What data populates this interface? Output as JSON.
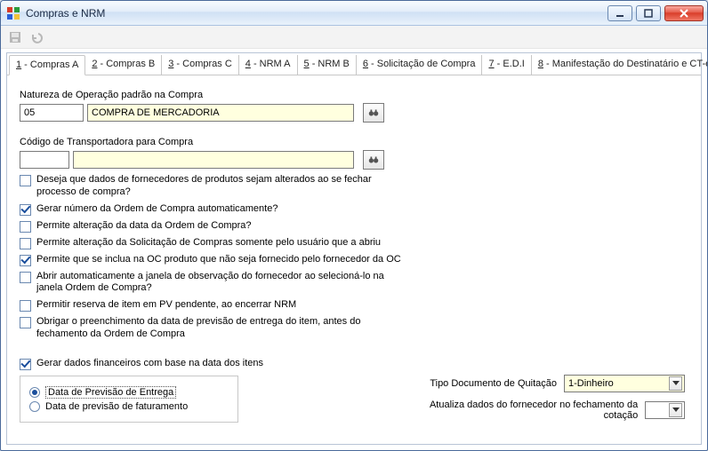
{
  "window": {
    "title": "Compras e NRM"
  },
  "tabs": [
    {
      "u": "1",
      "rest": " - Compras A",
      "active": true
    },
    {
      "u": "2",
      "rest": " - Compras B"
    },
    {
      "u": "3",
      "rest": " - Compras C"
    },
    {
      "u": "4",
      "rest": " - NRM A"
    },
    {
      "u": "5",
      "rest": " - NRM B"
    },
    {
      "u": "6",
      "rest": " - Solicitação de Compra"
    },
    {
      "u": "7",
      "rest": " - E.D.I"
    },
    {
      "u": "8",
      "rest": " - Manifestação do Destinatário e CT-e"
    }
  ],
  "fields": {
    "natureza_label": "Natureza de Operação padrão na Compra",
    "natureza_code": "05",
    "natureza_desc": "COMPRA DE MERCADORIA",
    "transp_label": "Código de Transportadora para Compra",
    "transp_code": "",
    "transp_desc": ""
  },
  "checkboxes": [
    {
      "label": "Deseja que dados de fornecedores de produtos sejam alterados ao se fechar processo de compra?",
      "checked": false
    },
    {
      "label": "Gerar número da Ordem de Compra automaticamente?",
      "checked": true
    },
    {
      "label": "Permite alteração da data da Ordem de Compra?",
      "checked": false
    },
    {
      "label": "Permite alteração da Solicitação de Compras somente pelo usuário que a abriu",
      "checked": false
    },
    {
      "label": "Permite que se inclua na OC produto que não seja fornecido pelo fornecedor da OC",
      "checked": true
    },
    {
      "label": "Abrir automaticamente a janela de observação do fornecedor ao selecioná-lo na janela Ordem de Compra?",
      "checked": false
    },
    {
      "label": "Permitir reserva de item em PV pendente, ao encerrar NRM",
      "checked": false
    },
    {
      "label": "Obrigar o preenchimento da data de previsão de entrega do item, antes do fechamento da Ordem de Compra",
      "checked": false
    },
    {
      "label": "Gerar dados financeiros com base na data dos itens",
      "checked": true
    }
  ],
  "radios": {
    "opt1": "Data de Previsão de Entrega",
    "opt2": "Data de previsão de faturamento"
  },
  "right": {
    "tipo_label": "Tipo Documento de Quitação",
    "tipo_value": "1-Dinheiro",
    "atualiza_label": "Atualiza dados do fornecedor no fechamento da cotação",
    "atualiza_value": ""
  }
}
